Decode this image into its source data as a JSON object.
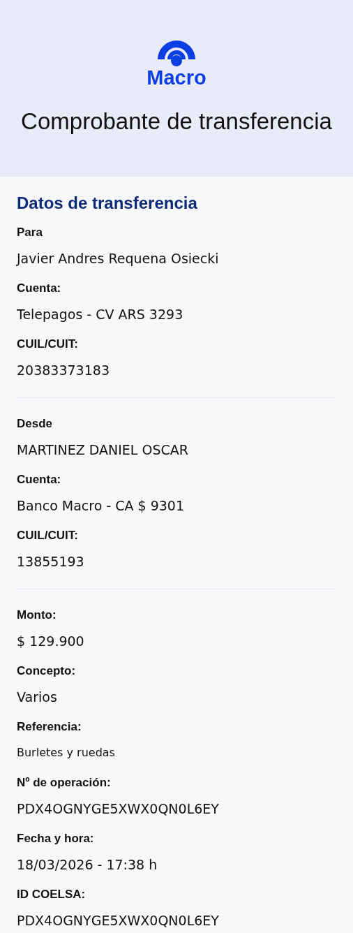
{
  "header": {
    "logo_text": "Macro",
    "title": "Comprobante de transferencia"
  },
  "section_title": "Datos de transferencia",
  "groups": [
    {
      "fields": [
        {
          "label": "Para",
          "value": "Javier Andres Requena Osiecki",
          "kind": "text"
        },
        {
          "label": "Cuenta:",
          "value": "Telepagos - CV ARS 3293",
          "kind": "text"
        },
        {
          "label": "CUIL/CUIT:",
          "value": "20383373183",
          "kind": "text"
        }
      ]
    },
    {
      "fields": [
        {
          "label": "Desde",
          "value": "MARTINEZ DANIEL OSCAR",
          "kind": "text"
        },
        {
          "label": "Cuenta:",
          "value": "Banco Macro - CA $ 9301",
          "kind": "text"
        },
        {
          "label": "CUIL/CUIT:",
          "value": "13855193",
          "kind": "text"
        }
      ]
    },
    {
      "fields": [
        {
          "label": "Monto:",
          "value": "$ 129.900",
          "kind": "text"
        },
        {
          "label": "Concepto:",
          "value": "Varios",
          "kind": "text"
        },
        {
          "label": "Referencia:",
          "value": "Burletes y ruedas",
          "kind": "small"
        },
        {
          "label": "Nº de operación:",
          "value": "PDX4OGNYGE5XWX0QN0L6EY",
          "kind": "text"
        },
        {
          "label": "Fecha y hora:",
          "value": "18/03/2026 - 17:38 h",
          "kind": "text"
        },
        {
          "label": "ID COELSA:",
          "value": "PDX4OGNYGE5XWX0QN0L6EY",
          "kind": "text"
        }
      ]
    }
  ]
}
